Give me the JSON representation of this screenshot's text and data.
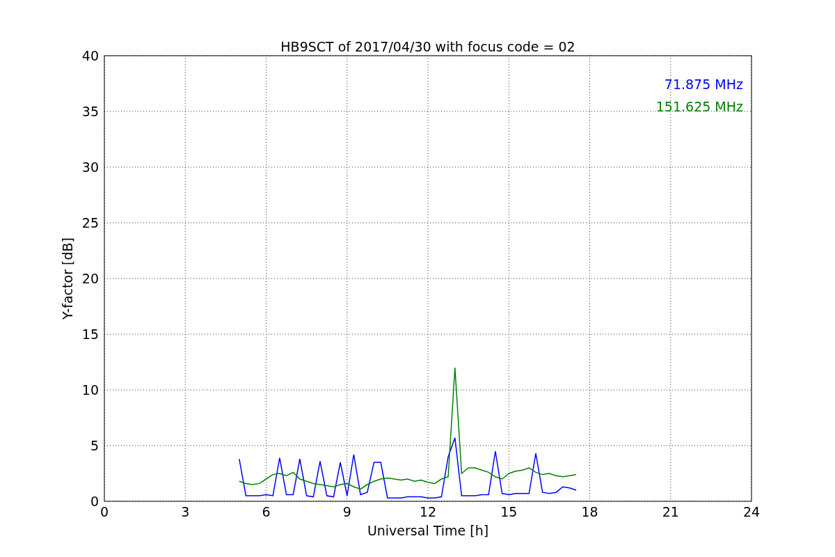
{
  "figure": {
    "chart_data": {
      "type": "line",
      "title": "HB9SCT of 2017/04/30 with focus code = 02",
      "xlabel": "Universal Time [h]",
      "ylabel": "Y-factor [dB]",
      "x": [
        5,
        5.25,
        5.5,
        5.75,
        6,
        6.25,
        6.5,
        6.75,
        7,
        7.25,
        7.5,
        7.75,
        8,
        8.25,
        8.5,
        8.75,
        9,
        9.25,
        9.5,
        9.75,
        10,
        10.25,
        10.5,
        10.75,
        11,
        11.25,
        11.5,
        11.75,
        12,
        12.25,
        12.5,
        12.75,
        13,
        13.25,
        13.5,
        13.75,
        14,
        14.25,
        14.5,
        14.75,
        15,
        15.25,
        15.5,
        15.75,
        16,
        16.25,
        16.5,
        16.75,
        17,
        17.25,
        17.5
      ],
      "series": [
        {
          "name": "71.875 MHz",
          "color": "#0000ff",
          "values": [
            3.8,
            0.5,
            0.5,
            0.5,
            0.6,
            0.5,
            3.9,
            0.6,
            0.6,
            3.8,
            0.5,
            0.4,
            3.6,
            0.5,
            0.4,
            3.5,
            0.5,
            4.2,
            0.6,
            0.8,
            3.5,
            3.5,
            0.3,
            0.3,
            0.3,
            0.4,
            0.4,
            0.4,
            0.3,
            0.3,
            0.4,
            4.0,
            5.7,
            0.5,
            0.5,
            0.5,
            0.6,
            0.6,
            4.5,
            0.7,
            0.6,
            0.7,
            0.7,
            0.7,
            4.3,
            0.8,
            0.7,
            0.8,
            1.3,
            1.2,
            1.0
          ]
        },
        {
          "name": "151.625 MHz",
          "color": "#008000",
          "values": [
            1.8,
            1.6,
            1.5,
            1.6,
            2.0,
            2.4,
            2.5,
            2.3,
            2.6,
            2.0,
            1.8,
            1.6,
            1.5,
            1.4,
            1.3,
            1.5,
            1.6,
            1.3,
            1.1,
            1.5,
            1.8,
            2.0,
            2.1,
            2.0,
            1.9,
            2.0,
            1.8,
            1.9,
            1.7,
            1.6,
            2.0,
            2.2,
            12.0,
            2.5,
            3.0,
            3.0,
            2.8,
            2.6,
            2.2,
            2.0,
            2.5,
            2.7,
            2.8,
            3.0,
            2.6,
            2.4,
            2.5,
            2.3,
            2.2,
            2.3,
            2.4
          ]
        }
      ],
      "xlim": [
        0,
        24
      ],
      "ylim": [
        0,
        40
      ],
      "xticks": [
        0,
        3,
        6,
        9,
        12,
        15,
        18,
        21,
        24
      ],
      "yticks": [
        0,
        5,
        10,
        15,
        20,
        25,
        30,
        35,
        40
      ],
      "grid": true
    }
  }
}
